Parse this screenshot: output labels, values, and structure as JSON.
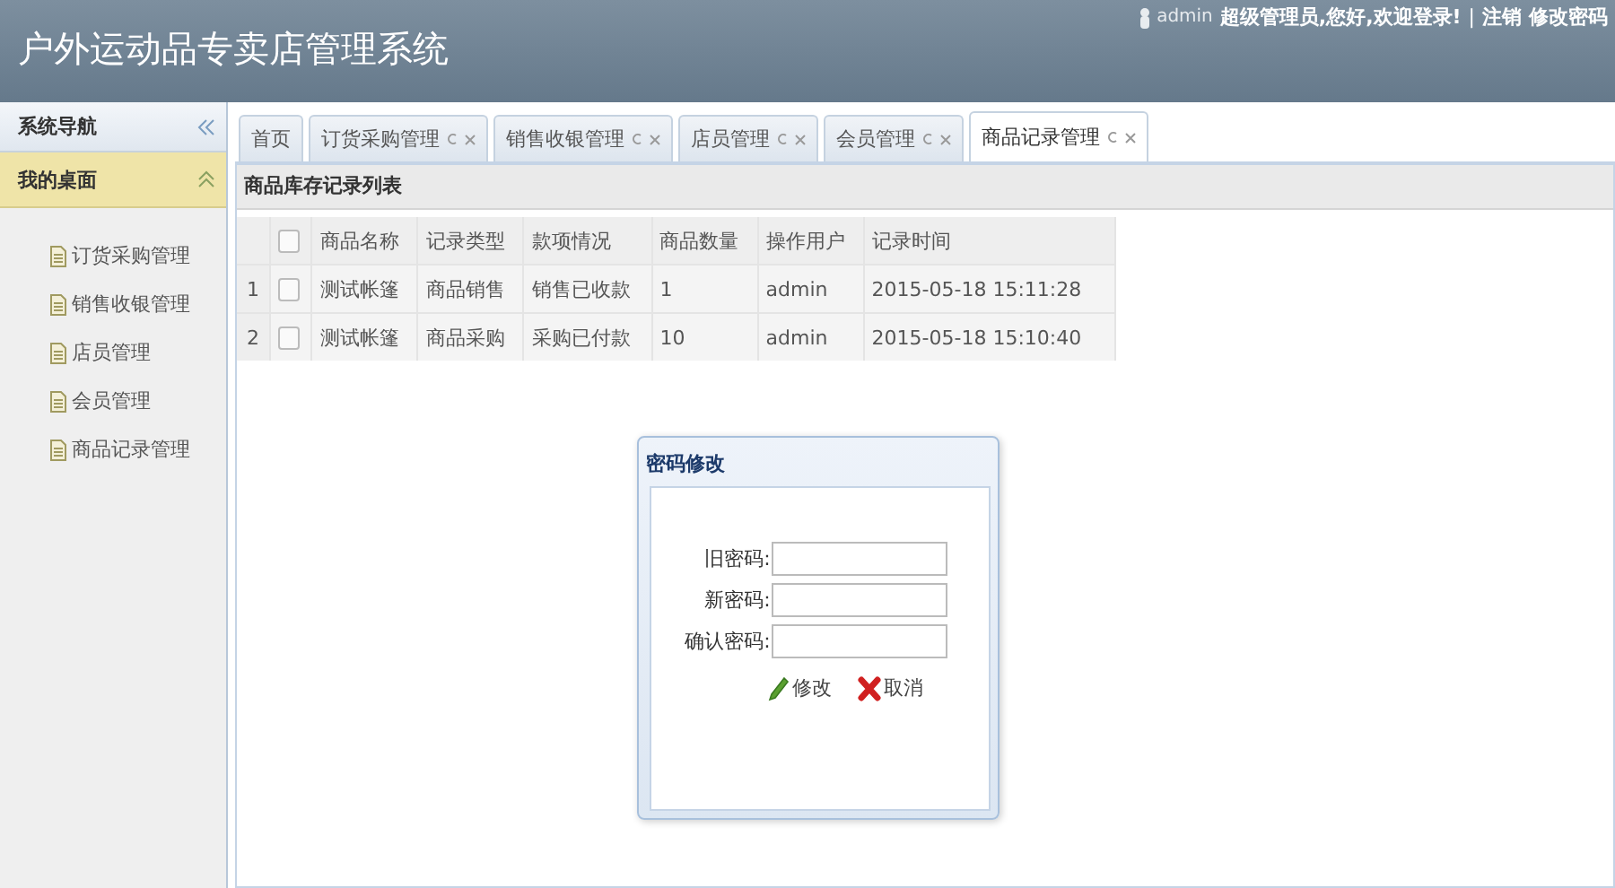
{
  "header": {
    "title": "户外运动品专卖店管理系统",
    "user": "admin",
    "greeting": "超级管理员,您好,欢迎登录!",
    "separator": "|",
    "links": [
      "注销",
      "修改密码"
    ]
  },
  "sidebar": {
    "title": "系统导航",
    "section": {
      "label": "我的桌面",
      "expanded": true
    },
    "items": [
      {
        "label": "订货采购管理"
      },
      {
        "label": "销售收银管理"
      },
      {
        "label": "店员管理"
      },
      {
        "label": "会员管理"
      },
      {
        "label": "商品记录管理"
      }
    ]
  },
  "tabs": [
    {
      "label": "首页",
      "closable": false,
      "selected": false
    },
    {
      "label": "订货采购管理",
      "closable": true,
      "selected": false
    },
    {
      "label": "销售收银管理",
      "closable": true,
      "selected": false
    },
    {
      "label": "店员管理",
      "closable": true,
      "selected": false
    },
    {
      "label": "会员管理",
      "closable": true,
      "selected": false
    },
    {
      "label": "商品记录管理",
      "closable": true,
      "selected": true
    }
  ],
  "panel": {
    "title": "商品库存记录列表"
  },
  "table": {
    "all_checked": false,
    "columns": [
      "商品名称",
      "记录类型",
      "款项情况",
      "商品数量",
      "操作用户",
      "记录时间"
    ],
    "rows": [
      {
        "number": "1",
        "checked": false,
        "cells": [
          "测试帐篷",
          "商品销售",
          "销售已收款",
          "1",
          "admin",
          "2015-05-18 15:11:28"
        ]
      },
      {
        "number": "2",
        "checked": false,
        "cells": [
          "测试帐篷",
          "商品采购",
          "采购已付款",
          "10",
          "admin",
          "2015-05-18 15:10:40"
        ]
      }
    ]
  },
  "dialog": {
    "title": "密码修改",
    "fields": [
      {
        "label": "旧密码:"
      },
      {
        "label": "新密码:"
      },
      {
        "label": "确认密码:"
      }
    ],
    "buttons": [
      {
        "kind": "edit",
        "label": "修改"
      },
      {
        "kind": "cancel",
        "label": "取消"
      }
    ]
  }
}
